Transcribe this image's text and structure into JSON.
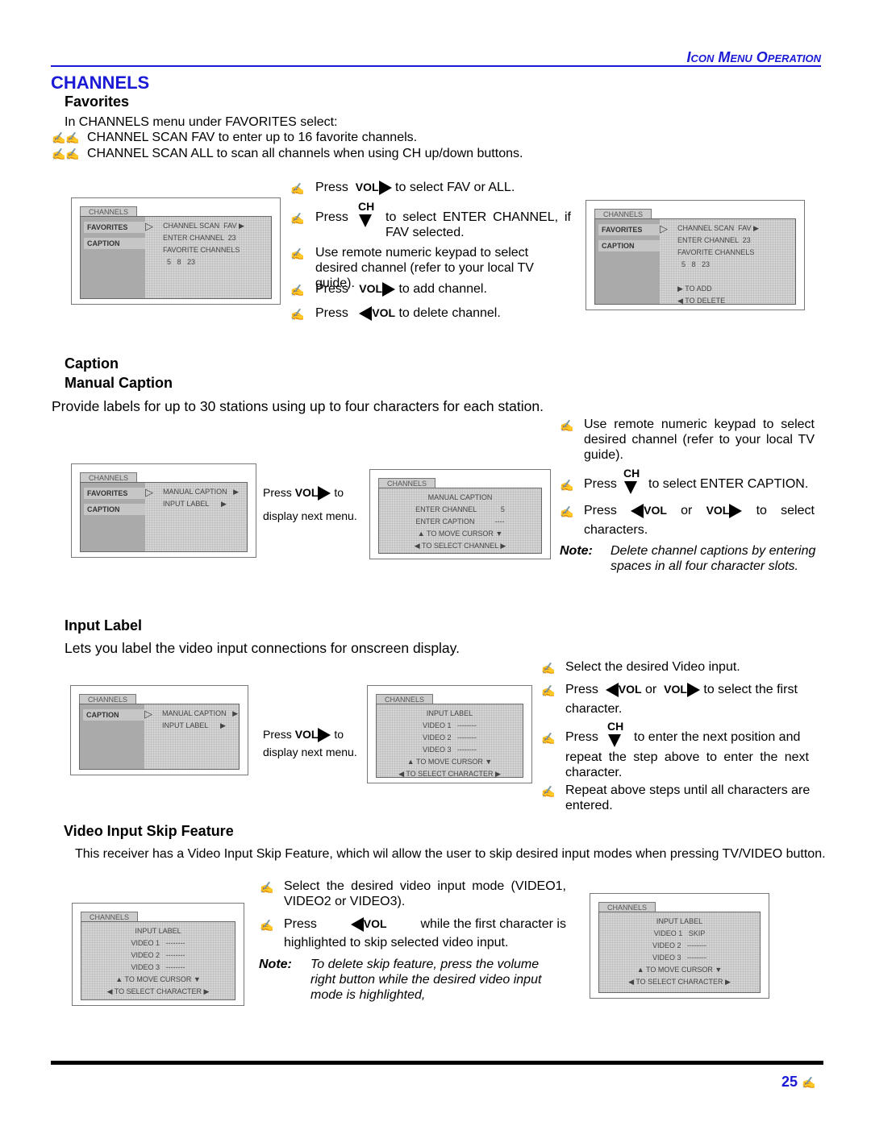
{
  "header": {
    "section": "Icon Menu Operation"
  },
  "title": "CHANNELS",
  "favorites": {
    "heading": "Favorites",
    "intro": "In CHANNELS menu under FAVORITES select:",
    "bullets": [
      "CHANNEL SCAN FAV to enter up to 16 favorite channels.",
      "CHANNEL SCAN ALL to scan all channels when using CH up/down buttons."
    ],
    "steps": {
      "s1a": "Press",
      "s1b": "to select FAV or ALL.",
      "s2a": "Press",
      "s2b": "to select ENTER CHANNEL, if FAV selected.",
      "s3": "Use remote numeric keypad to select desired channel (refer to your local TV guide).",
      "s4a": "Press",
      "s4b": "to add channel.",
      "s5a": "Press",
      "s5b": "to delete channel."
    }
  },
  "labels": {
    "vol": "VOL",
    "ch": "CH",
    "or": "or",
    "bullet": "✍"
  },
  "caption": {
    "heading": "Caption",
    "sub": "Manual Caption",
    "intro": "Provide labels for up to 30 stations using up to four characters for each station.",
    "press": "Press",
    "to": "to",
    "display": "display next menu.",
    "steps": {
      "s1": "Use remote numeric keypad to select desired channel (refer to your local TV guide).",
      "s2a": "Press",
      "s2b": "to select ENTER CAPTION.",
      "s3a": "Press",
      "s3b": "to select",
      "s3c": "characters."
    },
    "note_label": "Note:",
    "note": "Delete channel captions by entering spaces in all four character slots."
  },
  "input_label": {
    "heading": "Input Label",
    "intro": "Lets you label the video input connections for onscreen display.",
    "press": "Press",
    "to": "to",
    "display": "display next menu.",
    "steps": {
      "s1": "Select the desired Video input.",
      "s2a": "Press",
      "s2b": "to select the first",
      "s2c": "character.",
      "s3a": "Press",
      "s3b": "to enter the next position and",
      "s3c": "repeat the step above to enter the next character.",
      "s4": "Repeat above steps until all characters are entered."
    }
  },
  "skip": {
    "heading": "Video Input Skip Feature",
    "intro": "This receiver has a Video Input Skip Feature, which wil allow the user to skip desired input modes when pressing TV/VIDEO button.",
    "steps": {
      "s1": "Select the desired video input mode (VIDEO1, VIDEO2 or VIDEO3).",
      "s2a": "Press",
      "s2b": "while the first character is",
      "s2c": "highlighted to skip selected video input."
    },
    "note_label": "Note:",
    "note": "To delete skip feature, press the volume right button while the desired video input mode is highlighted,"
  },
  "menus": [
    {
      "tab": "CHANNELS",
      "left": [
        "FAVORITES",
        "CAPTION"
      ],
      "right": [
        "CHANNEL SCAN  FAV ▶",
        "ENTER CHANNEL  23",
        "FAVORITE CHANNELS",
        "  5   8   23"
      ]
    },
    {
      "tab": "CHANNELS",
      "left": [
        "FAVORITES",
        "CAPTION"
      ],
      "right": [
        "CHANNEL SCAN  FAV ▶",
        "ENTER CHANNEL  23",
        "FAVORITE CHANNELS",
        "  5   8   23",
        "",
        "▶ TO ADD",
        "◀ TO DELETE"
      ]
    },
    {
      "tab": "CHANNELS",
      "left": [
        "FAVORITES",
        "CAPTION"
      ],
      "right": [
        "MANUAL CAPTION   ▶",
        "INPUT LABEL      ▶"
      ]
    },
    {
      "tab": "CHANNELS",
      "center": [
        "MANUAL CAPTION",
        "ENTER CHANNEL            5",
        "ENTER CAPTION          ----",
        "▲ TO MOVE CURSOR ▼",
        "◀ TO SELECT CHANNEL ▶"
      ]
    },
    {
      "tab": "CHANNELS",
      "left": [
        "CAPTION"
      ],
      "right": [
        "MANUAL CAPTION   ▶",
        "INPUT LABEL      ▶"
      ]
    },
    {
      "tab": "CHANNELS",
      "center": [
        "INPUT LABEL",
        "VIDEO 1   --------",
        "VIDEO 2   --------",
        "VIDEO 3   --------",
        "▲ TO MOVE CURSOR ▼",
        "◀ TO SELECT CHARACTER ▶"
      ]
    },
    {
      "tab": "CHANNELS",
      "center": [
        "INPUT LABEL",
        "VIDEO 1   --------",
        "VIDEO 2   --------",
        "VIDEO 3   --------",
        "▲ TO MOVE CURSOR ▼",
        "◀ TO SELECT CHARACTER ▶"
      ]
    },
    {
      "tab": "CHANNELS",
      "center": [
        "INPUT LABEL",
        "VIDEO 1   SKIP",
        "VIDEO 2   --------",
        "VIDEO 3   --------",
        "▲ TO MOVE CURSOR ▼",
        "◀ TO SELECT CHARACTER ▶"
      ]
    }
  ],
  "footer": {
    "page": "25"
  },
  "colors": {
    "accent": "#1a1ad6"
  }
}
